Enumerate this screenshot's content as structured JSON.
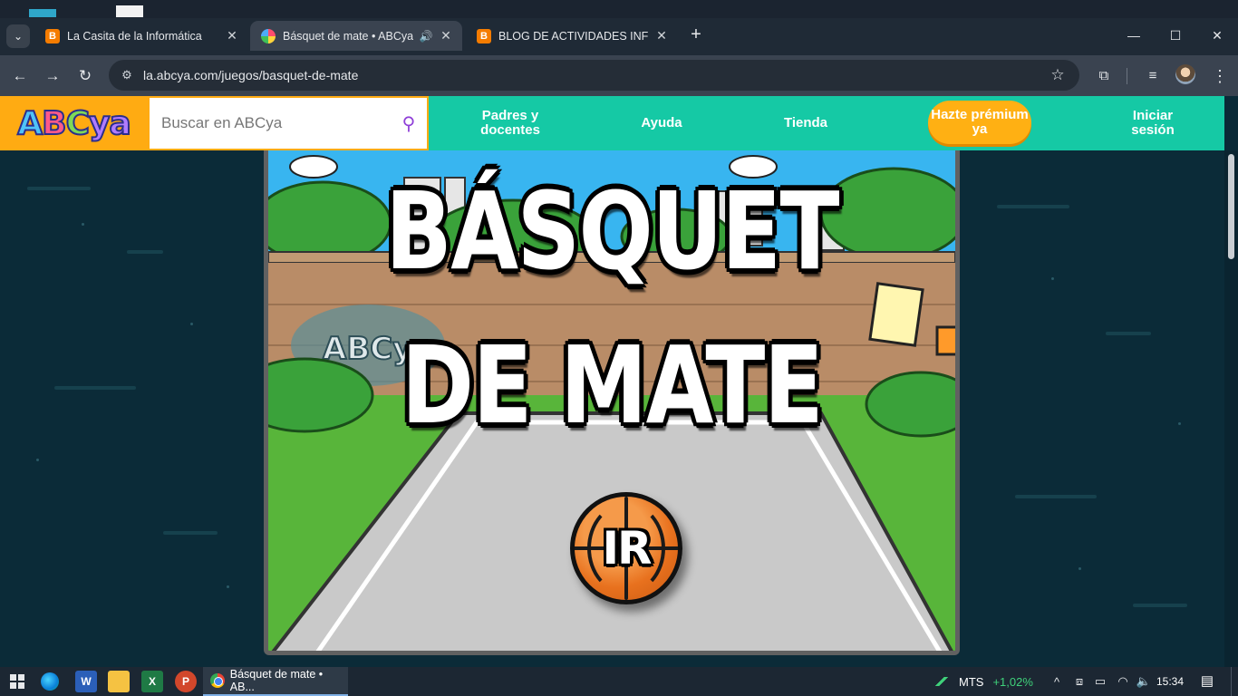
{
  "browser": {
    "tabs": [
      {
        "title": "La Casita de la Informática",
        "favicon": "blogger-icon",
        "active": false
      },
      {
        "title": "Básquet de mate • ABCya",
        "favicon": "abcya-icon",
        "active": true,
        "audio": true
      },
      {
        "title": "BLOG DE ACTIVIDADES INFORM",
        "favicon": "blogger-icon",
        "active": false
      }
    ],
    "url": "la.abcya.com/juegos/basquet-de-mate",
    "icons": {
      "tab_list": "chevron-down-icon",
      "new_tab": "plus-icon",
      "back": "arrow-left-icon",
      "forward": "arrow-right-icon",
      "reload": "reload-icon",
      "bookmark": "star-icon",
      "extensions": "puzzle-icon",
      "media": "media-controls-icon",
      "menu": "kebab-menu-icon"
    },
    "glyphs": {
      "tab_list": "⌄",
      "close": "✕",
      "audio": "🔊",
      "new_tab": "+",
      "minimize": "—",
      "maximize": "☐",
      "window_close": "✕",
      "back": "←",
      "forward": "→",
      "reload": "↻",
      "site_info": "⚙",
      "star": "☆",
      "extensions": "⧉",
      "media": "≡",
      "menu": "⋮"
    }
  },
  "site": {
    "logo": {
      "l1": "A",
      "l2": "B",
      "l3": "C",
      "l4": "ya"
    },
    "search": {
      "placeholder": "Buscar en ABCya",
      "icon": "search-icon",
      "glyph": "⚲"
    },
    "nav": {
      "parents": "Padres y docentes",
      "help": "Ayuda",
      "store": "Tienda",
      "premium": "Hazte prémium ya",
      "login": "Iniciar sesión"
    },
    "colors": {
      "header": "#15c9a5",
      "logo_bg": "#ffab12",
      "premium": "#ffb013",
      "page_bg": "#0b2b38"
    }
  },
  "game": {
    "title_line1": "BÁSQUET",
    "title_line2": "DE MATE",
    "play_label": "IR",
    "wall_logo": "ABCya"
  },
  "taskbar": {
    "apps": [
      "windows-start-icon",
      "edge-icon",
      "word-icon",
      "file-explorer-icon",
      "excel-icon",
      "powerpoint-icon"
    ],
    "app_glyphs": {
      "word": "W",
      "excel": "X",
      "powerpoint": "P"
    },
    "active_window": "Básquet de mate • AB...",
    "stock": {
      "symbol": "MTS",
      "change": "+1,02%"
    },
    "tray_glyphs": {
      "up": "^",
      "a": "⧈",
      "b": "▭",
      "wifi": "◠",
      "volume": "🔈",
      "notifications": "▤"
    },
    "time": "15:34"
  }
}
